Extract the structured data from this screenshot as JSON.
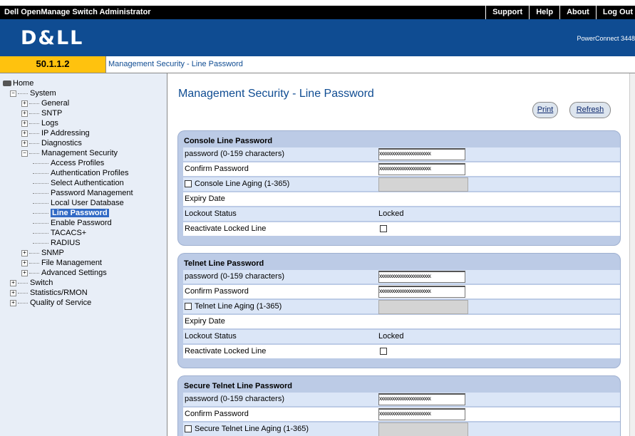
{
  "header": {
    "app_title": "Dell OpenManage Switch Administrator",
    "links": [
      "Support",
      "Help",
      "About",
      "Log Out"
    ],
    "logo": "D&LL",
    "model": "PowerConnect 3448"
  },
  "breadcrumb": {
    "ip": "50.1.1.2",
    "path": "Management Security - Line Password"
  },
  "sidebar": {
    "items": [
      {
        "label": "Home",
        "level": 0,
        "type": "home"
      },
      {
        "label": "System",
        "level": 1,
        "type": "minus"
      },
      {
        "label": "General",
        "level": 2,
        "type": "plus"
      },
      {
        "label": "SNTP",
        "level": 2,
        "type": "plus"
      },
      {
        "label": "Logs",
        "level": 2,
        "type": "plus"
      },
      {
        "label": "IP Addressing",
        "level": 2,
        "type": "plus"
      },
      {
        "label": "Diagnostics",
        "level": 2,
        "type": "plus"
      },
      {
        "label": "Management Security",
        "level": 2,
        "type": "minus"
      },
      {
        "label": "Access Profiles",
        "level": 3,
        "type": "leaf"
      },
      {
        "label": "Authentication Profiles",
        "level": 3,
        "type": "leaf"
      },
      {
        "label": "Select Authentication",
        "level": 3,
        "type": "leaf"
      },
      {
        "label": "Password Management",
        "level": 3,
        "type": "leaf"
      },
      {
        "label": "Local User Database",
        "level": 3,
        "type": "leaf"
      },
      {
        "label": "Line Password",
        "level": 3,
        "type": "leaf",
        "selected": true
      },
      {
        "label": "Enable Password",
        "level": 3,
        "type": "leaf"
      },
      {
        "label": "TACACS+",
        "level": 3,
        "type": "leaf"
      },
      {
        "label": "RADIUS",
        "level": 3,
        "type": "leaf"
      },
      {
        "label": "SNMP",
        "level": 2,
        "type": "plus"
      },
      {
        "label": "File Management",
        "level": 2,
        "type": "plus"
      },
      {
        "label": "Advanced Settings",
        "level": 2,
        "type": "plus"
      },
      {
        "label": "Switch",
        "level": 1,
        "type": "plus"
      },
      {
        "label": "Statistics/RMON",
        "level": 1,
        "type": "plus"
      },
      {
        "label": "Quality of Service",
        "level": 1,
        "type": "plus"
      }
    ]
  },
  "main": {
    "title": "Management Security - Line Password",
    "print_label": "Print",
    "refresh_label": "Refresh",
    "masked_value": "xxxxxxxxxxxxxxxxxxxxxxxx",
    "sections": [
      {
        "title": "Console Line Password",
        "password_label": "password (0-159 characters)",
        "confirm_label": "Confirm Password",
        "aging_label": "Console Line Aging (1-365)",
        "expiry_label": "Expiry Date",
        "lockout_label": "Lockout Status",
        "lockout_value": "Locked",
        "reactivate_label": "Reactivate Locked Line"
      },
      {
        "title": "Telnet Line Password",
        "password_label": "password (0-159 characters)",
        "confirm_label": "Confirm Password",
        "aging_label": "Telnet Line Aging (1-365)",
        "expiry_label": "Expiry Date",
        "lockout_label": "Lockout Status",
        "lockout_value": "Locked",
        "reactivate_label": "Reactivate Locked Line"
      },
      {
        "title": "Secure Telnet Line Password",
        "password_label": "password (0-159 characters)",
        "confirm_label": "Confirm Password",
        "aging_label": "Secure Telnet Line Aging (1-365)"
      }
    ]
  }
}
